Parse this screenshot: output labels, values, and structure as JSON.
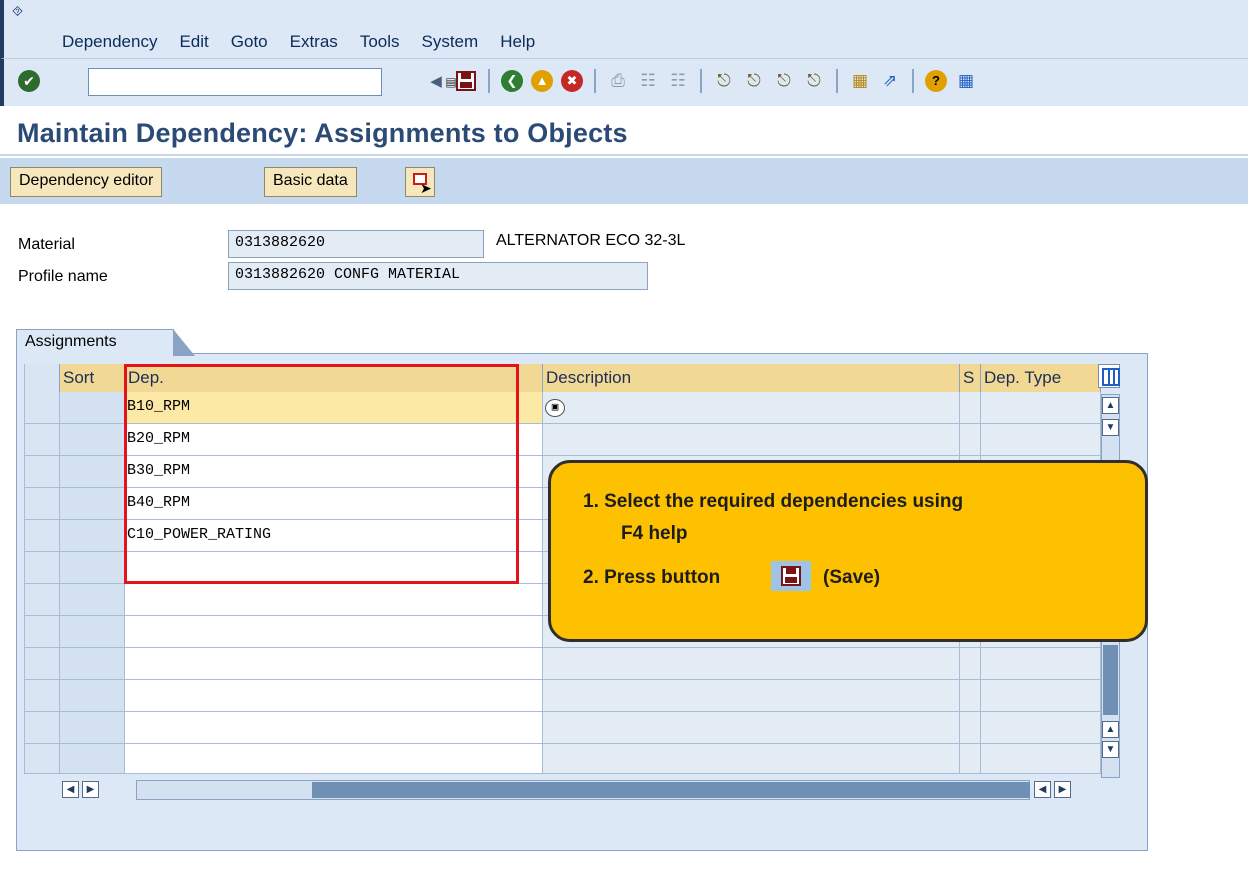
{
  "menubar": {
    "items": [
      "Dependency",
      "Edit",
      "Goto",
      "Extras",
      "Tools",
      "System",
      "Help"
    ]
  },
  "toolbar": {
    "command_value": "",
    "icons": [
      "enter-icon",
      "back-icon",
      "save-icon",
      "back-circle-icon",
      "exit-icon",
      "cancel-icon",
      "print-icon",
      "find-icon",
      "find-next-icon",
      "first-page-icon",
      "previous-page-icon",
      "next-page-icon",
      "last-page-icon",
      "create-session-icon",
      "shortcut-icon",
      "help-icon",
      "layout-icon"
    ]
  },
  "page": {
    "title": "Maintain Dependency: Assignments to Objects"
  },
  "app_toolbar": {
    "dependency_editor": "Dependency editor",
    "basic_data": "Basic data"
  },
  "fields": {
    "material_label": "Material",
    "material_value": "0313882620",
    "material_desc": "ALTERNATOR ECO 32-3L",
    "profile_label": "Profile name",
    "profile_value": "0313882620 CONFG MATERIAL"
  },
  "assignments": {
    "tab_label": "Assignments",
    "columns": {
      "sort": "Sort",
      "dep": "Dep.",
      "description": "Description",
      "s": "S",
      "dep_type": "Dep. Type"
    },
    "rows": [
      {
        "dep": "B10_RPM"
      },
      {
        "dep": "B20_RPM"
      },
      {
        "dep": "B30_RPM"
      },
      {
        "dep": "B40_RPM"
      },
      {
        "dep": "C10_POWER_RATING"
      },
      {
        "dep": ""
      },
      {
        "dep": ""
      },
      {
        "dep": ""
      },
      {
        "dep": ""
      },
      {
        "dep": ""
      },
      {
        "dep": ""
      },
      {
        "dep": ""
      }
    ]
  },
  "callout": {
    "line1": "1. Select the required dependencies using",
    "line1b": "F4 help",
    "line2a": "2. Press button",
    "line2b": "(Save)"
  },
  "colors": {
    "title": "#2b4a75",
    "highlight_box": "#e1141b",
    "callout_bg": "#fdc100"
  }
}
